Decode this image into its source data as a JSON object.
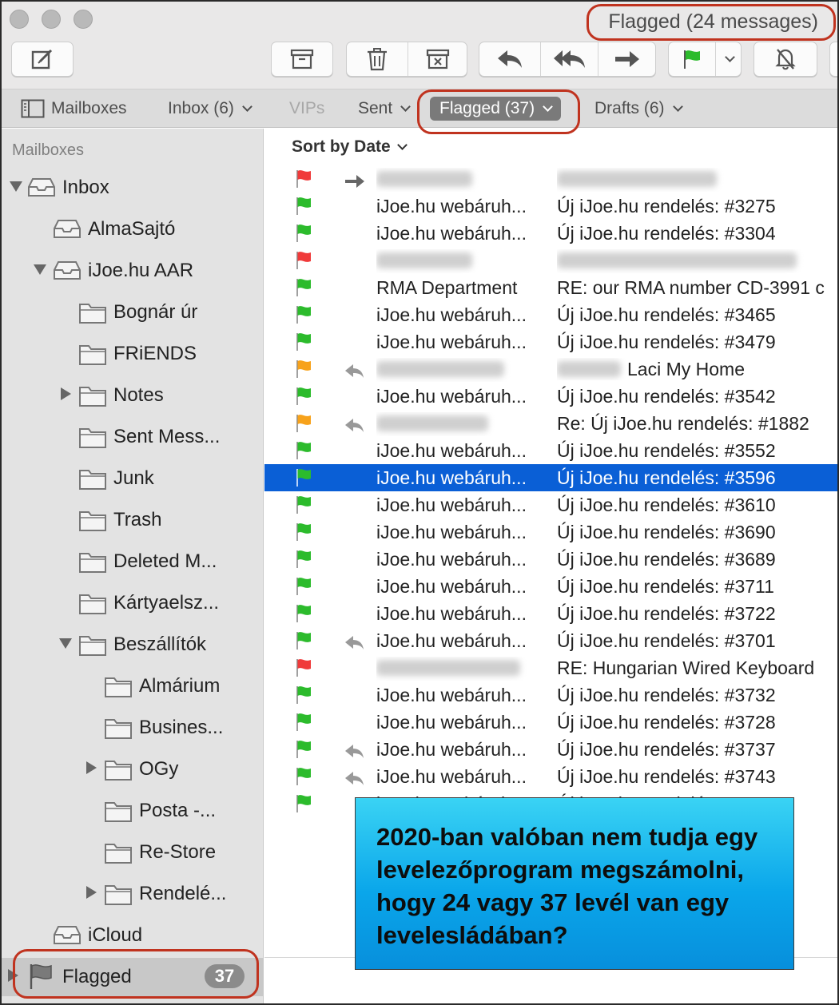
{
  "window": {
    "title": "Flagged (24 messages)"
  },
  "toolbar": {
    "buttons": [
      "compose-icon",
      "archive-icon",
      "trash-icon",
      "junk-icon",
      "reply-icon",
      "reply-all-icon",
      "forward-icon",
      "flag-icon",
      "mute-icon"
    ],
    "flag_color": "#2cbb2c"
  },
  "favorites": {
    "mailboxes": "Mailboxes",
    "inbox": "Inbox (6)",
    "vips": "VIPs",
    "sent": "Sent",
    "flagged": "Flagged (37)",
    "drafts": "Drafts (6)"
  },
  "sidebar": {
    "header": "Mailboxes",
    "items": [
      {
        "label": "Inbox"
      },
      {
        "label": "AlmaSajtó"
      },
      {
        "label": "iJoe.hu AAR"
      },
      {
        "label": "Bognár úr"
      },
      {
        "label": "FRiENDS"
      },
      {
        "label": "Notes"
      },
      {
        "label": "Sent Mess..."
      },
      {
        "label": "Junk"
      },
      {
        "label": "Trash"
      },
      {
        "label": "Deleted M..."
      },
      {
        "label": "Kártyaelsz..."
      },
      {
        "label": "Beszállítók"
      },
      {
        "label": "Almárium"
      },
      {
        "label": "Busines..."
      },
      {
        "label": "OGy"
      },
      {
        "label": "Posta  -..."
      },
      {
        "label": "Re-Store"
      },
      {
        "label": "Rendelé..."
      },
      {
        "label": "iCloud"
      },
      {
        "label": "Flagged",
        "badge": "37"
      }
    ]
  },
  "list": {
    "sort_label": "Sort by Date",
    "rows": [
      {
        "flag": "red",
        "from": "",
        "subject": ""
      },
      {
        "flag": "green",
        "from": "iJoe.hu webáruh...",
        "subject": "Új iJoe.hu rendelés: #3275"
      },
      {
        "flag": "green",
        "from": "iJoe.hu webáruh...",
        "subject": "Új iJoe.hu rendelés: #3304"
      },
      {
        "flag": "red",
        "from": "",
        "subject": ""
      },
      {
        "flag": "green",
        "from": "RMA Department",
        "subject": "RE: our RMA number CD-3991 c"
      },
      {
        "flag": "green",
        "from": "iJoe.hu webáruh...",
        "subject": "Új iJoe.hu rendelés: #3465"
      },
      {
        "flag": "green",
        "from": "iJoe.hu webáruh...",
        "subject": "Új iJoe.hu rendelés: #3479"
      },
      {
        "flag": "orange",
        "from": "",
        "subject": "Laci My Home"
      },
      {
        "flag": "green",
        "from": "iJoe.hu webáruh...",
        "subject": "Új iJoe.hu rendelés: #3542"
      },
      {
        "flag": "orange",
        "from": "",
        "subject": "Re: Új iJoe.hu rendelés: #1882"
      },
      {
        "flag": "green",
        "from": "iJoe.hu webáruh...",
        "subject": "Új iJoe.hu rendelés: #3552"
      },
      {
        "flag": "green",
        "from": "iJoe.hu webáruh...",
        "subject": "Új iJoe.hu rendelés: #3596"
      },
      {
        "flag": "green",
        "from": "iJoe.hu webáruh...",
        "subject": "Új iJoe.hu rendelés: #3610"
      },
      {
        "flag": "green",
        "from": "iJoe.hu webáruh...",
        "subject": "Új iJoe.hu rendelés: #3690"
      },
      {
        "flag": "green",
        "from": "iJoe.hu webáruh...",
        "subject": "Új iJoe.hu rendelés: #3689"
      },
      {
        "flag": "green",
        "from": "iJoe.hu webáruh...",
        "subject": "Új iJoe.hu rendelés: #3711"
      },
      {
        "flag": "green",
        "from": "iJoe.hu webáruh...",
        "subject": "Új iJoe.hu rendelés: #3722"
      },
      {
        "flag": "green",
        "from": "iJoe.hu webáruh...",
        "subject": "Új iJoe.hu rendelés: #3701"
      },
      {
        "flag": "red",
        "from": "",
        "subject": "RE: Hungarian Wired Keyboard"
      },
      {
        "flag": "green",
        "from": "iJoe.hu webáruh...",
        "subject": "Új iJoe.hu rendelés: #3732"
      },
      {
        "flag": "green",
        "from": "iJoe.hu webáruh...",
        "subject": "Új iJoe.hu rendelés: #3728"
      },
      {
        "flag": "green",
        "from": "iJoe.hu webáruh...",
        "subject": "Új iJoe.hu rendelés: #3737"
      },
      {
        "flag": "green",
        "from": "iJoe.hu webáruh...",
        "subject": "Új iJoe.hu rendelés: #3743"
      },
      {
        "flag": "green",
        "from": "iJoe.hu webáruh...",
        "subject": "Új iJoe.hu rendelés: #3756"
      }
    ]
  },
  "colors": {
    "flag_red": "#f03a3a",
    "flag_green": "#2cbb2c",
    "flag_orange": "#f7a21b",
    "selection": "#0a5fd6",
    "annotation_ring": "#c0331f",
    "callout_bg": "#19b6ef"
  },
  "annotation": {
    "text": "2020-ban valóban nem tudja egy levelezőprogram megszámolni, hogy 24 vagy 37 levél van egy levelesládában?"
  }
}
